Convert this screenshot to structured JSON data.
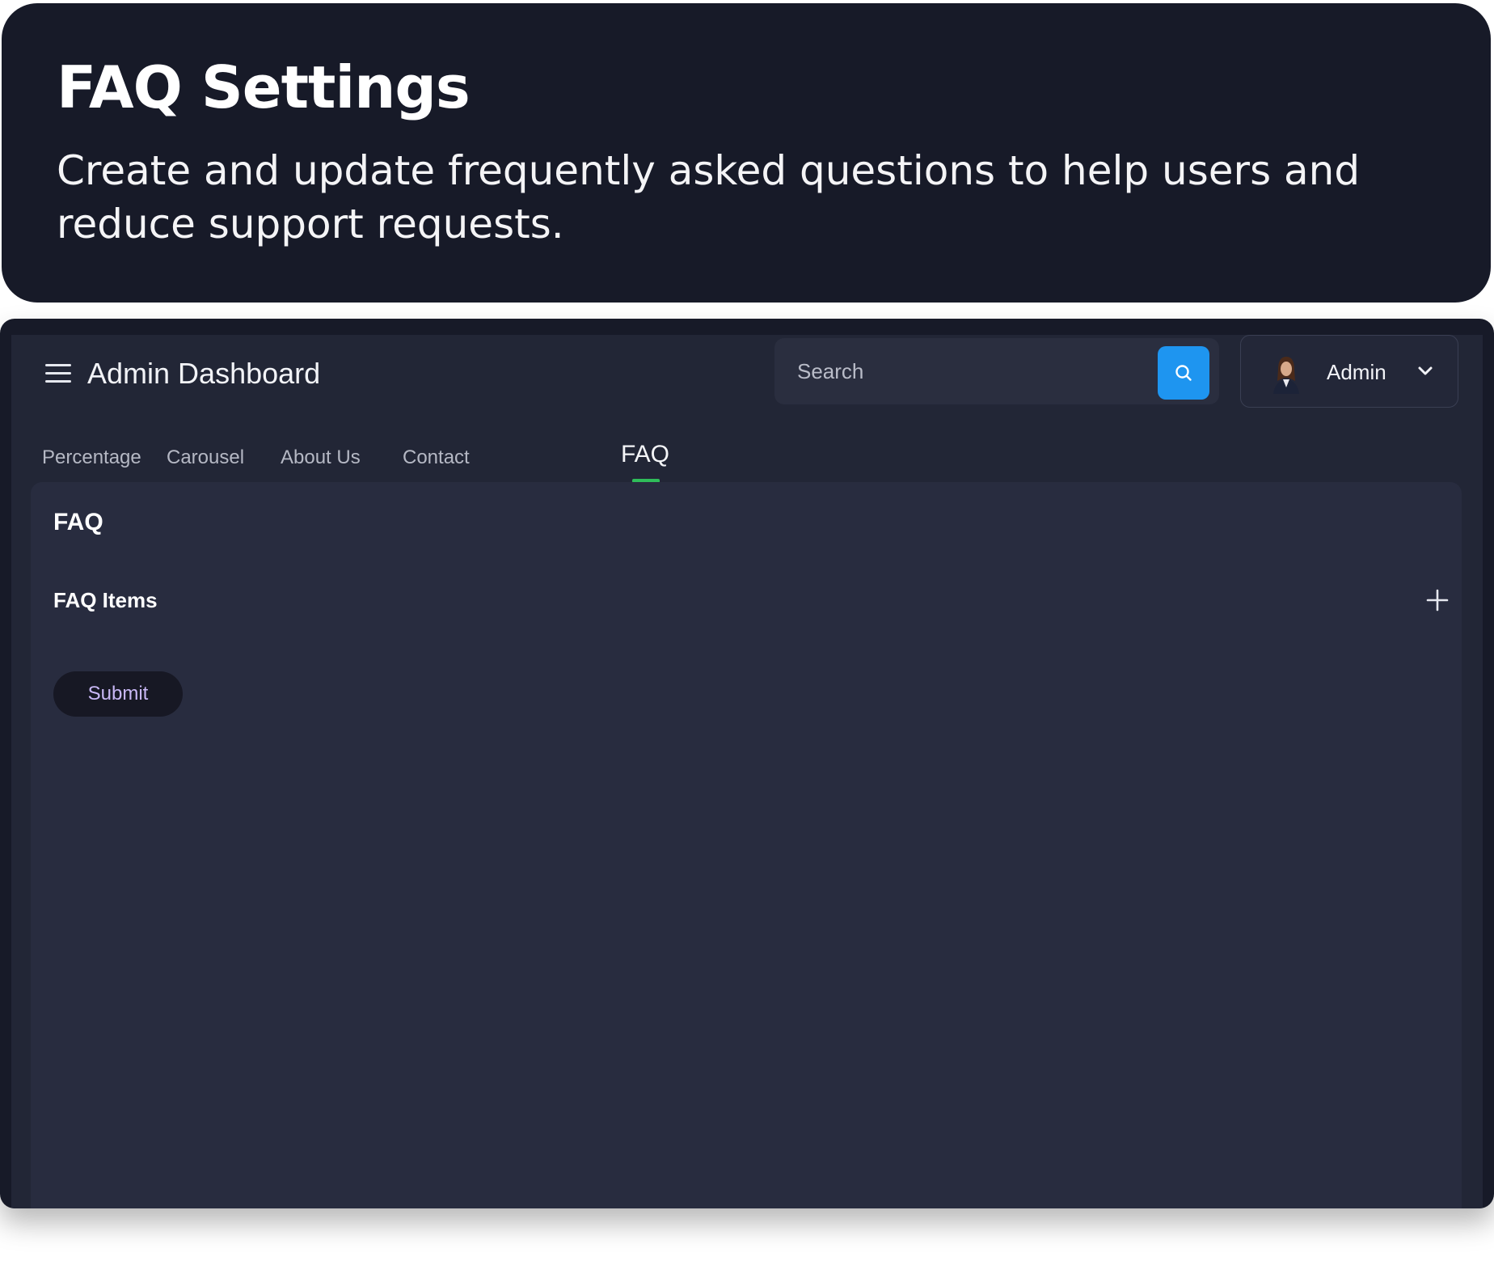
{
  "caption": {
    "title": "FAQ Settings",
    "subtitle_line1": "Create and update frequently asked questions to help users and",
    "subtitle_line2": "reduce support requests."
  },
  "header": {
    "title": "Admin Dashboard",
    "search_placeholder": "Search",
    "user_name": "Admin"
  },
  "tabs": [
    {
      "label": "Percentage"
    },
    {
      "label": "Carousel"
    },
    {
      "label": "About Us"
    },
    {
      "label": "Contact"
    },
    {
      "label": "FAQ"
    }
  ],
  "active_tab": "FAQ",
  "panel": {
    "title": "FAQ",
    "items_label": "FAQ Items",
    "submit_label": "Submit"
  },
  "colors": {
    "accent_blue": "#1e95f0",
    "active_tab_indicator": "#2fbd5a",
    "submit_text": "#c9b8f6"
  }
}
